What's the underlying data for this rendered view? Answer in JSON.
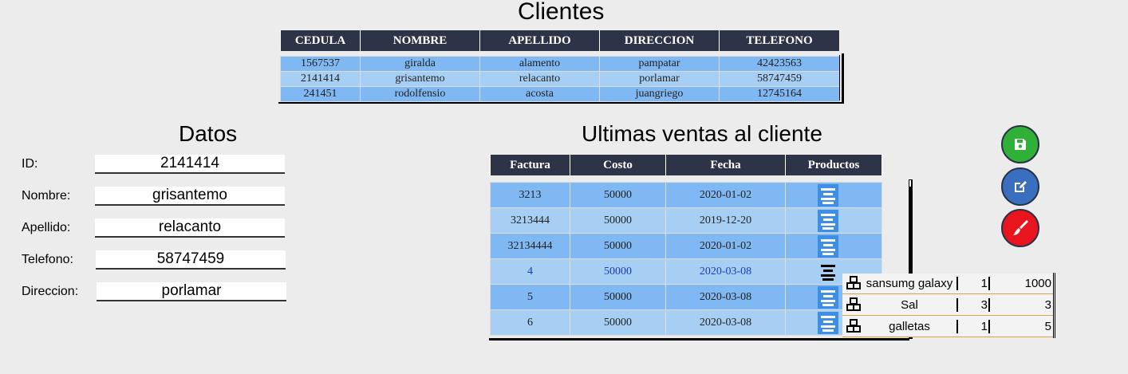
{
  "clientes": {
    "title": "Clientes",
    "headers": [
      "CEDULA",
      "NOMBRE",
      "APELLIDO",
      "DIRECCION",
      "TELEFONO"
    ],
    "rows": [
      [
        "1567537",
        "giralda",
        "alamento",
        "pampatar",
        "42423563"
      ],
      [
        "2141414",
        "grisantemo",
        "relacanto",
        "porlamar",
        "58747459"
      ],
      [
        "241451",
        "rodolfensio",
        "acosta",
        "juangriego",
        "12745164"
      ]
    ]
  },
  "datos": {
    "title": "Datos",
    "fields": [
      {
        "label": "ID:",
        "value": "2141414"
      },
      {
        "label": "Nombre:",
        "value": "grisantemo"
      },
      {
        "label": "Apellido:",
        "value": "relacanto"
      },
      {
        "label": "Telefono:",
        "value": "58747459"
      },
      {
        "label": "Direccion:",
        "value": "porlamar"
      }
    ]
  },
  "ventas": {
    "title": "Ultimas ventas al cliente",
    "headers": [
      "Factura",
      "Costo",
      "Fecha",
      "Productos"
    ],
    "rows": [
      [
        "3213",
        "50000",
        "2020-01-02"
      ],
      [
        "3213444",
        "50000",
        "2019-12-20"
      ],
      [
        "32134444",
        "50000",
        "2020-01-02"
      ],
      [
        "4",
        "50000",
        "2020-03-08"
      ],
      [
        "5",
        "50000",
        "2020-03-08"
      ],
      [
        "6",
        "50000",
        "2020-03-08"
      ]
    ]
  },
  "products_popup": {
    "items": [
      {
        "name": "sansumg galaxy",
        "qty": "1",
        "price": "1000"
      },
      {
        "name": "Sal",
        "qty": "3",
        "price": "3"
      },
      {
        "name": "galletas",
        "qty": "1",
        "price": "5"
      }
    ]
  },
  "actions": {
    "save_color": "#2fb036",
    "edit_color": "#3a6fc0",
    "clear_color": "#e8141e",
    "icons": [
      "save-icon",
      "edit-icon",
      "broom-icon"
    ]
  },
  "colors": {
    "header_bg": "#2e3448",
    "row_dark": "#7fb8f2",
    "row_light": "#a7cff4",
    "product_button": "#3d8ee8"
  }
}
